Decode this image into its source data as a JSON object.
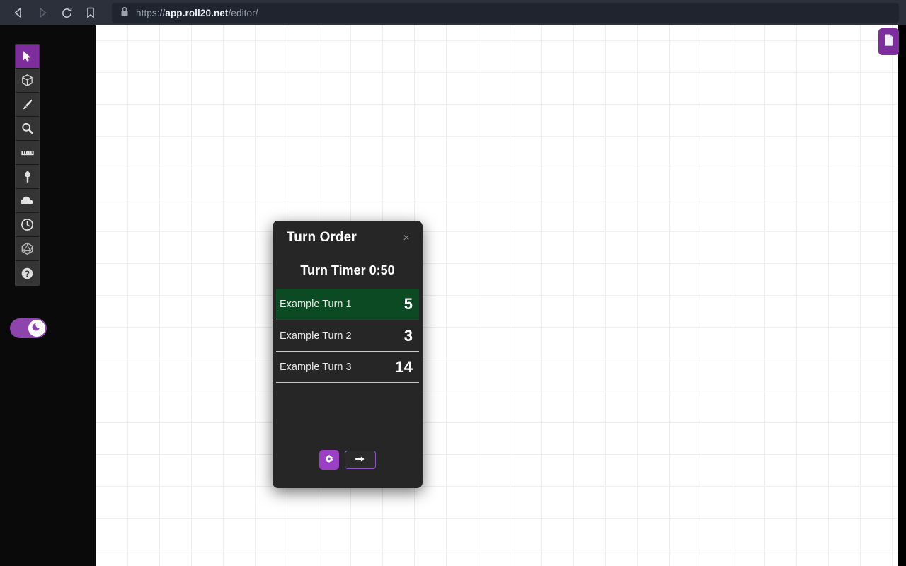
{
  "browser": {
    "back_label": "Back",
    "forward_label": "Forward",
    "reload_label": "Reload",
    "bookmark_label": "Bookmark this page",
    "url_scheme": "https://",
    "url_host": "app.roll20.net",
    "url_path": "/editor/",
    "url_full": "https://app.roll20.net/editor/"
  },
  "toolbar": {
    "tools": [
      {
        "name": "select-tool",
        "icon": "cursor-arrow-icon",
        "label": "Select",
        "active": true
      },
      {
        "name": "shape-tool",
        "icon": "cube-icon",
        "label": "Shapes",
        "active": false
      },
      {
        "name": "draw-tool",
        "icon": "paintbrush-icon",
        "label": "Draw",
        "active": false
      },
      {
        "name": "zoom-tool",
        "icon": "magnifier-icon",
        "label": "Zoom",
        "active": false
      },
      {
        "name": "measure-tool",
        "icon": "ruler-icon",
        "label": "Measure",
        "active": false
      },
      {
        "name": "fog-tool",
        "icon": "torch-icon",
        "label": "Lighting",
        "active": false
      },
      {
        "name": "fog-cloud-tool",
        "icon": "cloud-icon",
        "label": "Fog of War",
        "active": false
      },
      {
        "name": "turn-order-tool",
        "icon": "clock-icon",
        "label": "Turn Order",
        "active": false
      },
      {
        "name": "dice-tool",
        "icon": "d20-dice-icon",
        "label": "Dice Roller",
        "active": false
      },
      {
        "name": "help-tool",
        "icon": "question-mark-icon",
        "label": "Help",
        "active": false
      }
    ],
    "darkmode": {
      "label": "Dark Mode",
      "icon": "moon-icon",
      "enabled": true
    },
    "page_button": {
      "label": "Pages",
      "icon": "page-document-icon"
    }
  },
  "turn_order": {
    "title": "Turn Order",
    "close_label": "×",
    "timer_label": "Turn Timer 0:50",
    "rows": [
      {
        "name": "Example Turn 1",
        "value": "5",
        "current": true
      },
      {
        "name": "Example Turn 2",
        "value": "3",
        "current": false
      },
      {
        "name": "Example Turn 3",
        "value": "14",
        "current": false
      }
    ],
    "settings_button_label": "Settings",
    "settings_icon": "gear-icon",
    "next_button_label": "Next Turn",
    "next_icon": "arrow-right-icon"
  },
  "colors": {
    "accent_purple": "#7d2d9c",
    "active_turn_green": "#0c4a23",
    "chrome_bg": "#2b303b",
    "dialog_bg": "#262626"
  }
}
